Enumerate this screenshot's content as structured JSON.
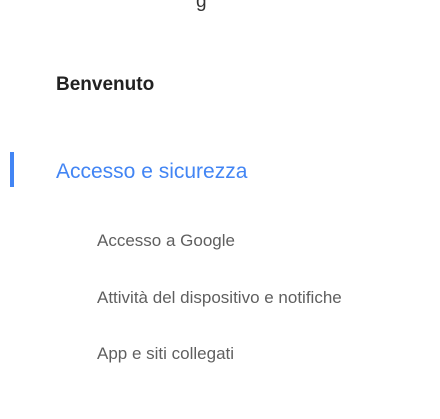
{
  "header": {
    "title_fragment": "g"
  },
  "nav": {
    "welcome_label": "Benvenuto",
    "active_section": {
      "label": "Accesso e sicurezza",
      "accent_color": "#4285f4",
      "items": [
        {
          "label": "Accesso a Google"
        },
        {
          "label": "Attività del dispositivo e notifiche"
        },
        {
          "label": "App e siti collegati"
        }
      ]
    }
  }
}
